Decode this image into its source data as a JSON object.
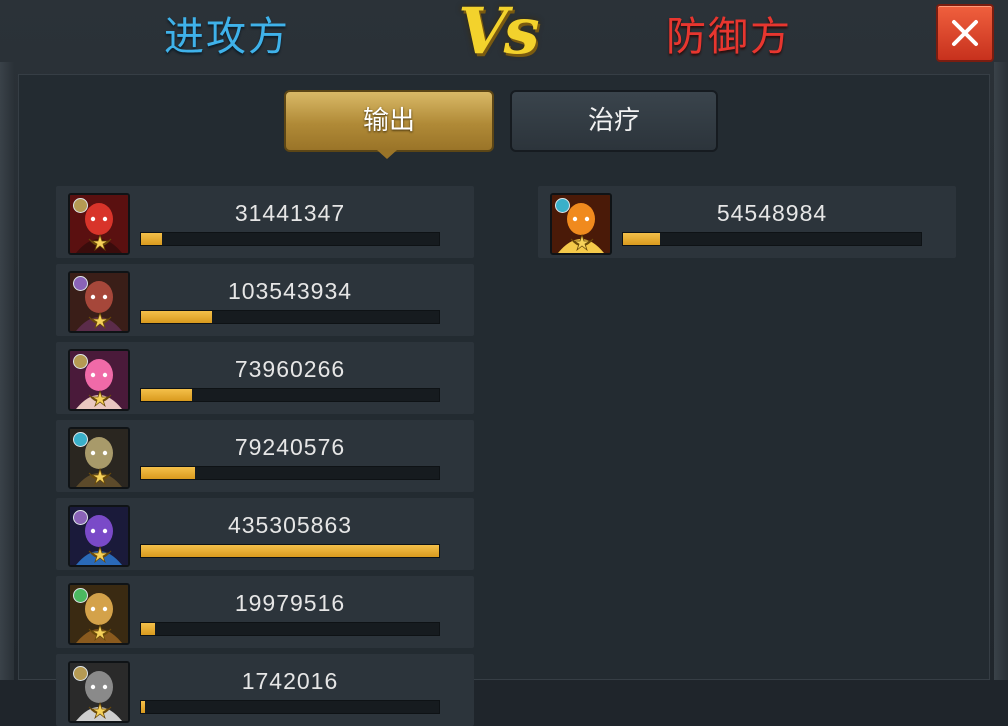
{
  "header": {
    "attacker_label": "进攻方",
    "vs_label": "Vs",
    "defender_label": "防御方",
    "close_icon": "close-icon"
  },
  "tabs": [
    {
      "label": "输出",
      "active": true
    },
    {
      "label": "治疗",
      "active": false
    }
  ],
  "attackers": [
    {
      "damage": "31441347",
      "fill": 0.072,
      "type_color": "#b59a53",
      "portrait": "red-armored-hero"
    },
    {
      "damage": "103543934",
      "fill": 0.238,
      "type_color": "#8a63b8",
      "portrait": "demon-brute"
    },
    {
      "damage": "73960266",
      "fill": 0.17,
      "type_color": "#b59a53",
      "portrait": "pink-haired-heroine"
    },
    {
      "damage": "79240576",
      "fill": 0.182,
      "type_color": "#3ab0c9",
      "portrait": "skull-sorceress"
    },
    {
      "damage": "435305863",
      "fill": 1.0,
      "type_color": "#8a63b8",
      "portrait": "purple-cyborg"
    },
    {
      "damage": "19979516",
      "fill": 0.046,
      "type_color": "#4cb85f",
      "portrait": "golden-warrior"
    },
    {
      "damage": "1742016",
      "fill": 0.004,
      "type_color": "#b59a53",
      "portrait": "partial-hero"
    }
  ],
  "defenders": [
    {
      "damage": "54548984",
      "fill": 0.125,
      "type_color": "#3ab0c9",
      "portrait": "flame-beast"
    }
  ],
  "colors": {
    "accent_gold": "#e0a826",
    "attacker_blue": "#3fb2ea",
    "defender_red": "#e8362f"
  }
}
